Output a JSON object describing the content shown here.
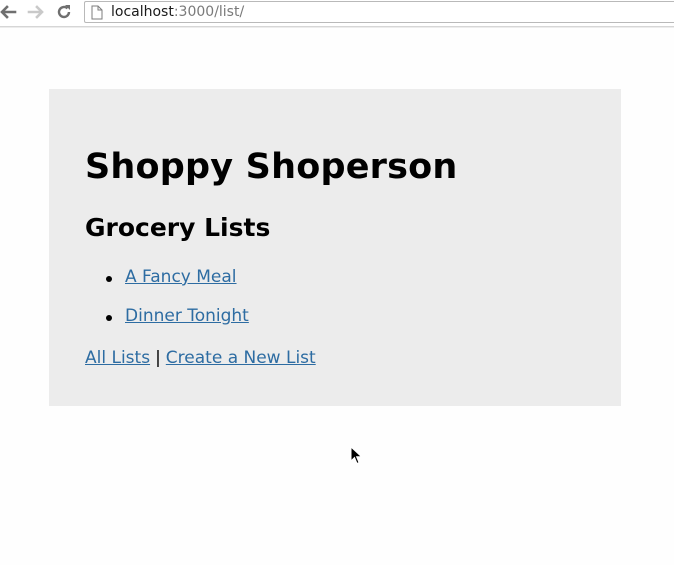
{
  "browser": {
    "url_host": "localhost",
    "url_rest": ":3000/list/",
    "icons": {
      "back": "back-arrow-icon",
      "forward": "forward-arrow-icon",
      "reload": "reload-icon",
      "page": "page-icon"
    }
  },
  "page": {
    "site_title": "Shoppy Shoperson",
    "section_title": "Grocery Lists",
    "lists": [
      {
        "label": "A Fancy Meal"
      },
      {
        "label": "Dinner Tonight"
      }
    ],
    "footer": {
      "all_lists": "All Lists",
      "separator": "|",
      "create_new": "Create a New List"
    }
  },
  "colors": {
    "card_background": "#ececec",
    "link": "#2d6ca2",
    "page_background": "#fefefe"
  }
}
